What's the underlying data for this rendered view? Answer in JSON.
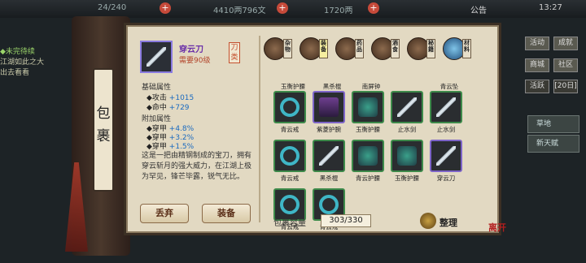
{
  "top": {
    "stamina": "24/240",
    "silver": "4410两796文",
    "gold": "1720两",
    "notice": "公告",
    "time": "13:27"
  },
  "quest": {
    "title": "◆未完待续",
    "line1": "江湖如此之大",
    "line2": "出去看看"
  },
  "right_menu": {
    "row1": [
      "活动",
      "成就"
    ],
    "row2": [
      "商城",
      "社区"
    ],
    "row3": [
      "活跃",
      "[20日]"
    ],
    "panels": [
      "草地",
      "新天赋"
    ]
  },
  "spine_text": [
    "包",
    "裹"
  ],
  "item": {
    "name": "穿云刀",
    "requirement": "需要90级",
    "type_tag": "刀类",
    "base_title": "基础属性",
    "base_stats": [
      {
        "label": "◆攻击",
        "value": "+1015"
      },
      {
        "label": "◆命中",
        "value": "+729"
      }
    ],
    "extra_title": "附加属性",
    "extra_stats": [
      {
        "label": "◆穿甲",
        "value": "+4.8%"
      },
      {
        "label": "◆穿甲",
        "value": "+3.2%"
      },
      {
        "label": "◆穿甲",
        "value": "+1.5%"
      }
    ],
    "description": "这是一把由精钢制成的宝刀，拥有穿云斩月的强大威力，在江湖上极为罕见，锋芒毕露，锐气无比。"
  },
  "buttons": {
    "discard": "丢弃",
    "equip": "装备",
    "sort": "整理"
  },
  "categories": [
    {
      "label": "杂物",
      "selected": false
    },
    {
      "label": "装备",
      "selected": true
    },
    {
      "label": "药品",
      "selected": false
    },
    {
      "label": "酒食",
      "selected": false
    },
    {
      "label": "秘籍",
      "selected": false
    },
    {
      "label": "材料",
      "selected": false
    }
  ],
  "row_top_labels": [
    "玉衡护腰",
    "黑杀棍",
    "南屏钟",
    "",
    "青云坠"
  ],
  "grid": [
    {
      "name": "青云戒",
      "kind": "ring",
      "border": "grn"
    },
    {
      "name": "紫菱护腕",
      "kind": "boot",
      "border": "rare"
    },
    {
      "name": "玉衡护腰",
      "kind": "armor",
      "border": "grn"
    },
    {
      "name": "止水剑",
      "kind": "blade",
      "border": "grn"
    },
    {
      "name": "止水剑",
      "kind": "blade",
      "border": "grn"
    },
    {
      "name": "青云戒",
      "kind": "ring",
      "border": "grn"
    },
    {
      "name": "黑杀棍",
      "kind": "blade",
      "border": "grn"
    },
    {
      "name": "青云护腰",
      "kind": "armor",
      "border": "grn"
    },
    {
      "name": "玉衡护腰",
      "kind": "armor",
      "border": "grn"
    },
    {
      "name": "穿云刀",
      "kind": "blade",
      "border": "rare"
    },
    {
      "name": "青云戒",
      "kind": "ring",
      "border": "grn"
    },
    {
      "name": "青云戒",
      "kind": "ring",
      "border": "grn"
    }
  ],
  "capacity": {
    "label": "包裹容量",
    "value": "303/330"
  },
  "seal_text": "离开"
}
